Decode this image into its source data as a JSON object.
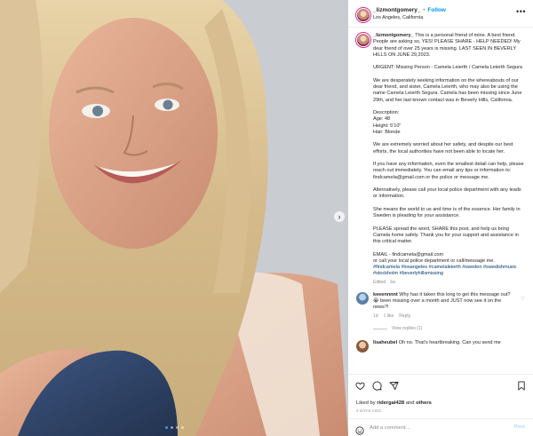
{
  "header": {
    "username": "_lizmontgomery_",
    "separator": "•",
    "follow_label": "Follow",
    "location": "Los Angeles, California",
    "more_icon": "more-icon"
  },
  "caption": {
    "username": "_lizmontgomery_",
    "intro": "This is a personal friend of mine. A best friend. People are asking so, YES! PLEASE SHARE - HELP NEEDED! My dear friend of over 25 years is missing. LAST SEEN IN BEVERLY HILLS ON JUNE 29,2023.",
    "urgent": "URGENT: Missing Person - Camela Leierth / Camela Leierth Segura",
    "p1": "We are desperately seeking information on the whereabouts of our dear friend, and sister, Camela Leierth, who may also be using the name Camela Leierth Segura. Camela has been missing since June 29th, and her last known contact was in Beverly Hills, California.",
    "desc_title": "Description:",
    "age": "Age: 48",
    "height": "Height: 5'10\"",
    "hair": "Hair: Blonde",
    "p2": "We are extremely worried about her safety, and despite our best efforts, the local authorities have not been able to locate her.",
    "p3": "If you have any information, even the smallest detail can help, please reach out immediately. You can email any tips or information to: findcamela@gmail.com or the police or message me.",
    "p4": "Alternatively, please call your local police department with any leads or information.",
    "p5": "She means the world to us and time is of the essence. Her family in Sweden is pleading for your assistance.",
    "p6": "PLEASE spread the word, SHARE this post, and help us bring Camela home safely. Thank you for your support and assistance in this critical matter.",
    "email_line": "EMAIL - findcamela@gmail.com",
    "call_line": "or call your local police department or call/message me.",
    "hashtags": "#findcamela #losangeles #camelaleierth #sweden #swedishmusic #stockholm #beverlyhillsmissing",
    "edited": "Edited",
    "edited_sep": "·",
    "edited_time": "1w"
  },
  "comment1": {
    "username": "keeennnnt",
    "text": "Why has it taken this long to get this message out? 😭 been missing over a month and JUST now see it on the news?!",
    "time": "1d",
    "likes": "1 like",
    "reply": "Reply",
    "view_replies": "View replies (1)"
  },
  "comment2": {
    "username": "lisaheubel",
    "text": "Oh no. That's heartbreaking. Can you send me"
  },
  "footer": {
    "liked_prefix": "Liked by",
    "liked_user": "ridergal428",
    "liked_and": "and",
    "liked_others": "others",
    "ago": "2 DAYS AGO",
    "comment_placeholder": "Add a comment...",
    "post_label": "Post"
  },
  "icons": {
    "heart": "heart-icon",
    "comment": "comment-icon",
    "share": "share-icon",
    "save": "bookmark-icon",
    "emoji": "emoji-icon",
    "carousel": "chevron-right-icon"
  },
  "colors": {
    "link_blue": "#0095f6",
    "hashtag_blue": "#00376b",
    "muted": "#8e8e8e",
    "post_disabled": "#b3dbff"
  }
}
